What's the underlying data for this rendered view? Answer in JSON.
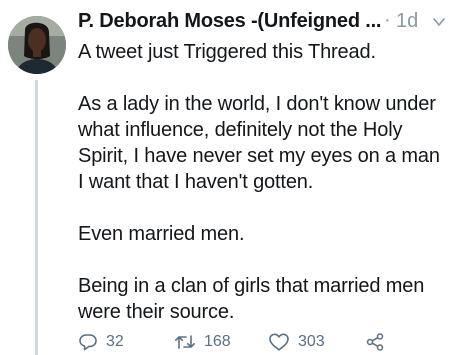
{
  "tweet": {
    "author": "P. Deborah Moses -(Unfeigned ...",
    "separator": "·",
    "time": "1d",
    "paragraphs": [
      "A tweet just Triggered this Thread.",
      "As a lady in the world, I don't know under what influence, definitely not the Holy Spirit, I have never set my eyes on a man I want that I haven't gotten.",
      "Even married men.",
      "Being in a clan of girls that married men were their source."
    ],
    "actions": {
      "replies": "32",
      "retweets": "168",
      "likes": "303"
    }
  },
  "colors": {
    "text": "#14171a",
    "muted": "#5b7083",
    "meta": "#8899a6",
    "thread_line": "#cfd9de"
  },
  "icons": [
    "reply-icon",
    "retweet-icon",
    "like-icon",
    "share-icon",
    "chevron-down-icon"
  ]
}
